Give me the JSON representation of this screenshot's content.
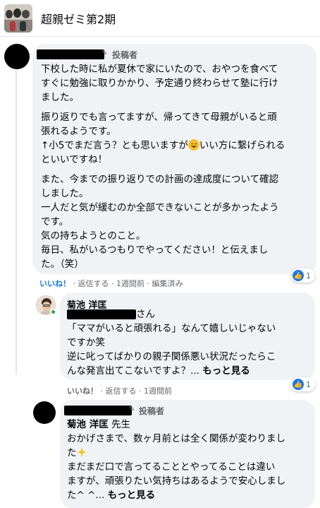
{
  "group": {
    "title": "超親ゼミ第2期"
  },
  "comment1": {
    "badge": "投稿者",
    "paragraph1": [
      "下校した時に私が夏休で家にいたので、おやつを食べて",
      "すぐに勉強に取りかかり、予定通り終わらせて塾に行け",
      "ました。"
    ],
    "paragraph2": [
      "振り返りでも言ってますが、帰ってきて母親がいると頑",
      "張れるようです。"
    ],
    "paragraph2_line3_pre": "↑小5でまだ言う？とも思いますが",
    "paragraph2_line3_post": "いい方に繋げられる",
    "paragraph2_line4": "といいですね！",
    "paragraph3": [
      "また、今までの振り返りでの計画の達成度について確認",
      "しました。",
      "一人だと気が緩むのか全部できないことが多かったよう",
      "です。",
      "気の持ちようとのこと。",
      "毎日、私がいるつもりでやってください！と伝えまし",
      "た。（笑）"
    ],
    "actions": {
      "like": "いいね！",
      "reply": "返信する",
      "time": "1週間前",
      "edited": "編集済み"
    },
    "reactions": {
      "count": "1"
    }
  },
  "reply1": {
    "author": "菊池 洋匡",
    "salutation": "さん",
    "lines": [
      "「ママがいると頑張れる」なんて嬉しいじゃない",
      "ですか笑",
      "逆に叱ってばかりの親子関係悪い状況だったらこ"
    ],
    "last_line": "んな発言出てこないですよ？...",
    "more": "もっと見る",
    "actions": {
      "like": "いいね！",
      "reply": "返信する",
      "time": "1週間前"
    },
    "reactions": {
      "count": "1"
    }
  },
  "reply2": {
    "badge": "投稿者",
    "mention": "菊池 洋匡",
    "mention_suffix": " 先生",
    "line1": "おかげさまで、数ヶ月前とは全く関係が変わりまし",
    "line2": "た",
    "lines": [
      "まだまだ口で言ってることとやってることは違い",
      "ますが、頑張りたい気持ちはあるようで安心しまし"
    ],
    "last_line": "た^ ^...",
    "more": "もっと見る"
  }
}
